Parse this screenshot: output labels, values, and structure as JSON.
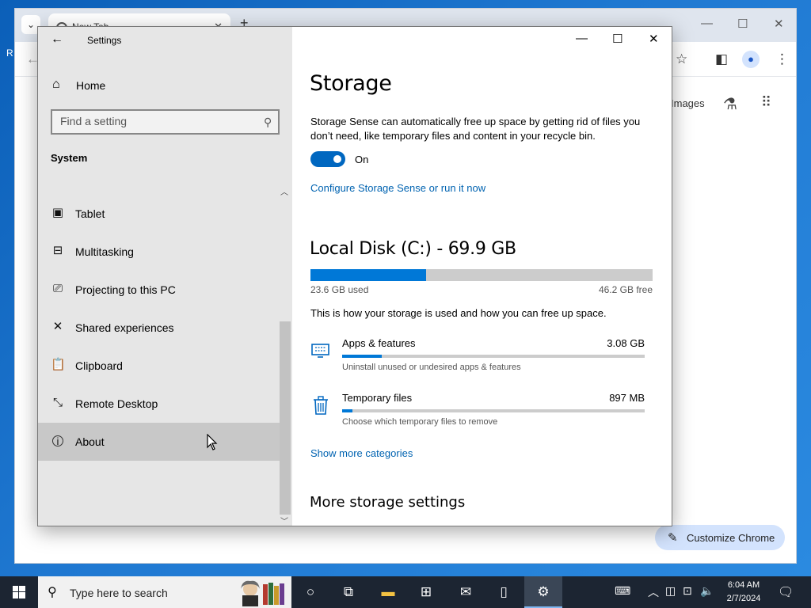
{
  "chrome": {
    "tab_title": "New Tab",
    "images_link": "Images",
    "customize_label": "Customize Chrome"
  },
  "settings": {
    "window_title": "Settings",
    "home_label": "Home",
    "search_placeholder": "Find a setting",
    "section_label": "System",
    "nav_items": [
      {
        "label": "Tablet",
        "icon": "tablet-icon"
      },
      {
        "label": "Multitasking",
        "icon": "multitasking-icon"
      },
      {
        "label": "Projecting to this PC",
        "icon": "projecting-icon"
      },
      {
        "label": "Shared experiences",
        "icon": "shared-experiences-icon"
      },
      {
        "label": "Clipboard",
        "icon": "clipboard-icon"
      },
      {
        "label": "Remote Desktop",
        "icon": "remote-desktop-icon"
      },
      {
        "label": "About",
        "icon": "info-icon"
      }
    ],
    "page_title": "Storage",
    "storage_sense_desc": "Storage Sense can automatically free up space by getting rid of files you don’t need, like temporary files and content in your recycle bin.",
    "storage_sense_state": "On",
    "configure_link": "Configure Storage Sense or run it now",
    "disk_title": "Local Disk (C:) - 69.9 GB",
    "disk_used": "23.6 GB used",
    "disk_free": "46.2 GB free",
    "disk_used_fraction": 0.338,
    "usage_desc": "This is how your storage is used and how you can free up space.",
    "categories": [
      {
        "name": "Apps & features",
        "size": "3.08 GB",
        "desc": "Uninstall unused or undesired apps & features",
        "fraction": 0.13,
        "icon": "apps-features-icon"
      },
      {
        "name": "Temporary files",
        "size": "897 MB",
        "desc": "Choose which temporary files to remove",
        "fraction": 0.035,
        "icon": "trash-icon"
      }
    ],
    "show_more_link": "Show more categories",
    "more_settings_heading": "More storage settings"
  },
  "taskbar": {
    "search_placeholder": "Type here to search",
    "time": "6:04 AM",
    "date": "2/7/2024"
  },
  "colors": {
    "accent": "#0078d7",
    "link": "#0063b1",
    "taskbar": "#1c2532"
  }
}
